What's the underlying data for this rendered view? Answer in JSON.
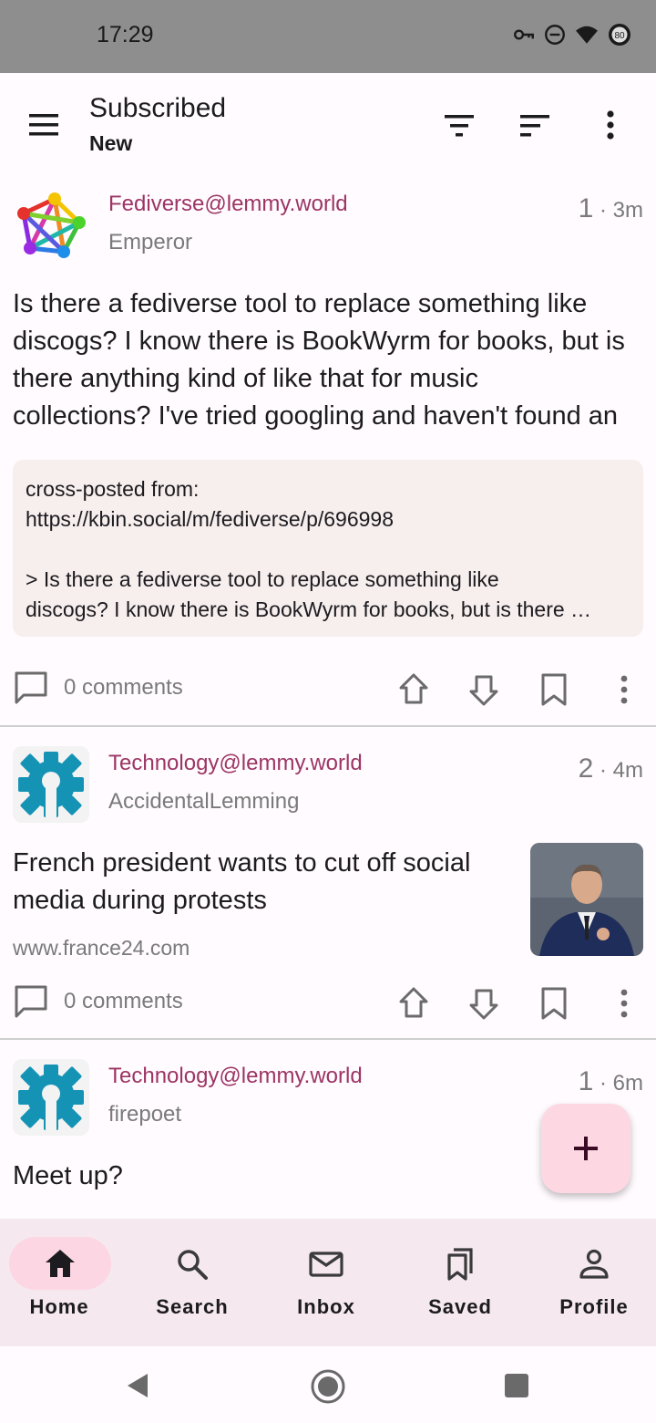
{
  "status_bar": {
    "time": "17:29",
    "battery": "80"
  },
  "app_bar": {
    "title": "Subscribed",
    "subtitle": "New"
  },
  "posts": [
    {
      "community": "Fediverse@lemmy.world",
      "author": "Emperor",
      "score": "1",
      "age": "3m",
      "title_lines": [
        "Is there a fediverse tool to replace something like",
        "discogs? I know there is BookWyrm for books, but is",
        "there anything kind of like that for music",
        "collections? I've tried googling and haven't found an"
      ],
      "body_lines": [
        "cross-posted from:",
        "https://kbin.social/m/fediverse/p/696998",
        "",
        "> Is there a fediverse tool to replace something like",
        "discogs? I know there is BookWyrm for books, but is there …"
      ],
      "comments": "0 comments"
    },
    {
      "community": "Technology@lemmy.world",
      "author": "AccidentalLemming",
      "score": "2",
      "age": "4m",
      "title_lines": [
        "French president wants to cut off social",
        "media during protests"
      ],
      "domain": "www.france24.com",
      "comments": "0 comments"
    },
    {
      "community": "Technology@lemmy.world",
      "author": "firepoet",
      "score": "1",
      "age": "6m",
      "title_lines": [
        "Meet up?"
      ]
    }
  ],
  "bottom_nav": [
    {
      "label": "Home",
      "icon": "home-icon"
    },
    {
      "label": "Search",
      "icon": "search-icon"
    },
    {
      "label": "Inbox",
      "icon": "mail-icon"
    },
    {
      "label": "Saved",
      "icon": "bookmarks-icon"
    },
    {
      "label": "Profile",
      "icon": "person-icon"
    }
  ],
  "colors": {
    "accent": "#9c3565",
    "fab_bg": "#fdd8e3",
    "nav_bg": "#f5e9ef",
    "body_box": "#f7eeee"
  }
}
